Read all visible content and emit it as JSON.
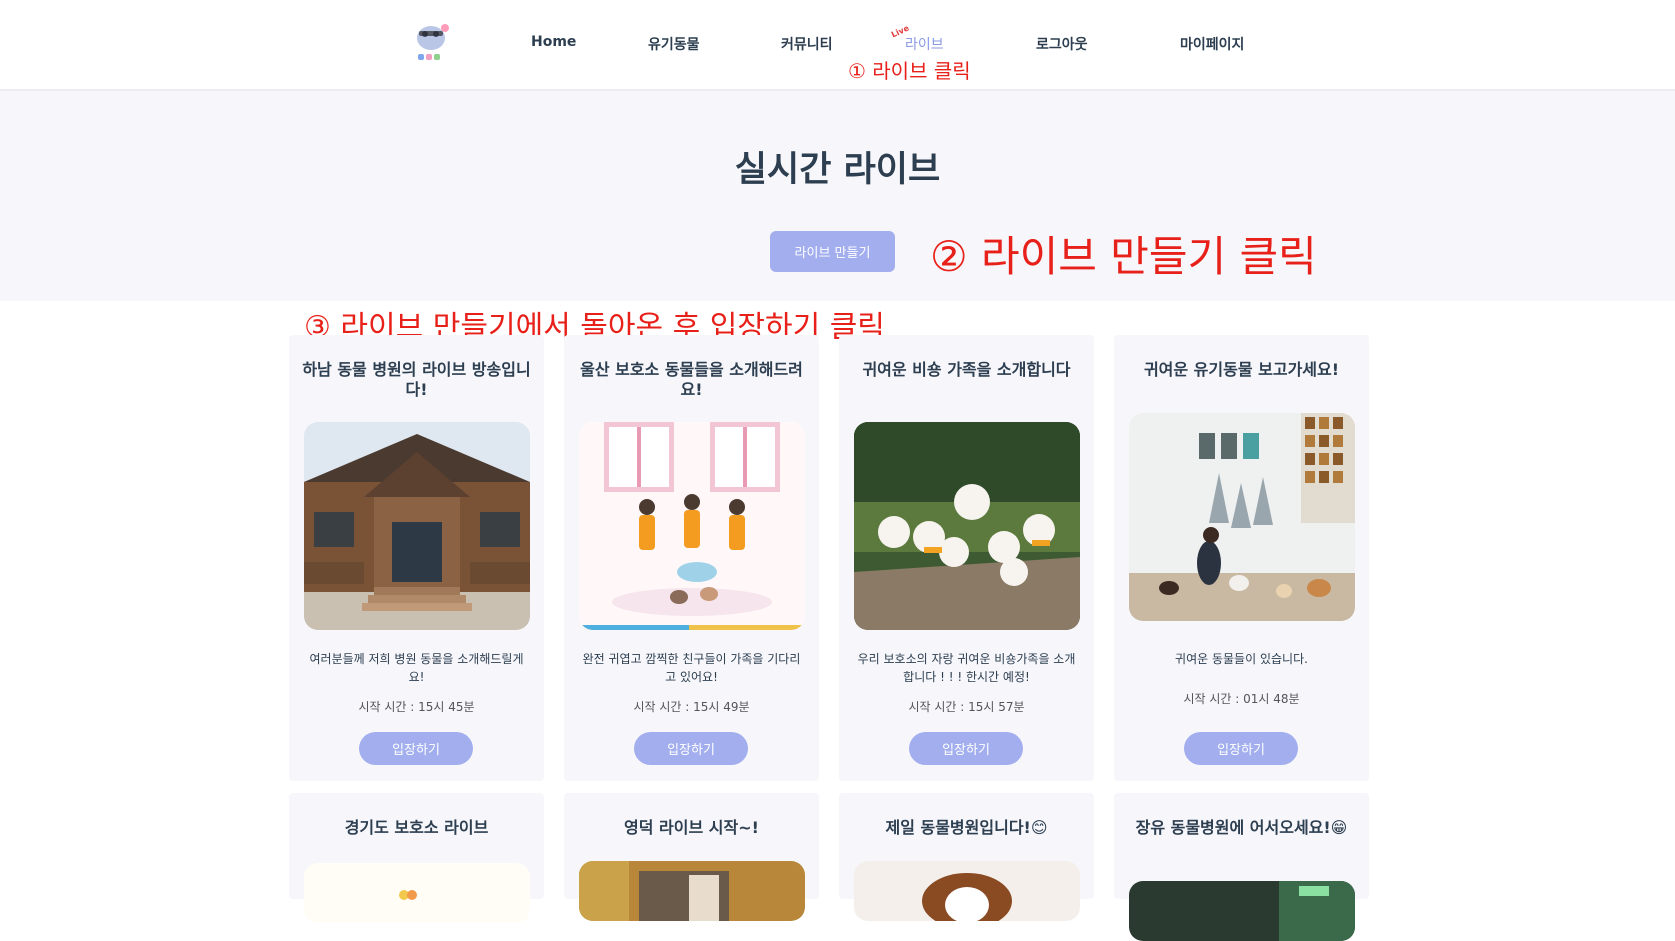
{
  "header": {
    "nav": [
      {
        "label": "Home"
      },
      {
        "label": "유기동물"
      },
      {
        "label": "커뮤니티"
      },
      {
        "label": "라이브",
        "badge": "Live"
      },
      {
        "label": "로그아웃"
      },
      {
        "label": "마이페이지"
      }
    ]
  },
  "hero": {
    "title": "실시간 라이브",
    "create_button": "라이브 만들기"
  },
  "annotations": {
    "step1": "① 라이브 클릭",
    "step2": "② 라이브 만들기 클릭",
    "step3": "③ 라이브 만들기에서 돌아온 후 입장하기 클릭",
    "color": "#e8201a"
  },
  "cards": [
    {
      "title": "하남 동물 병원의 라이브 방송입니다!",
      "desc": "여러분들께 저희 병원 동물을 소개해드릴게요!",
      "time": "시작 시간 : 15시 45분",
      "button": "입장하기"
    },
    {
      "title": "울산 보호소 동물들을 소개해드려요!",
      "desc": "완전 귀엽고 깜찍한 친구들이 가족을 기다리고 있어요!",
      "time": "시작 시간 : 15시 49분",
      "button": "입장하기"
    },
    {
      "title": "귀여운 비숑 가족을 소개합니다",
      "desc": "우리 보호소의 자랑 귀여운 비숑가족을 소개합니다 ! ! ! 한시간 예정!",
      "time": "시작 시간 : 15시 57분",
      "button": "입장하기"
    },
    {
      "title": "귀여운 유기동물 보고가세요!",
      "desc": "귀여운 동물들이 있습니다.",
      "time": "시작 시간 : 01시 48분",
      "button": "입장하기"
    },
    {
      "title": "경기도 보호소 라이브"
    },
    {
      "title": "영덕 라이브 시작~!"
    },
    {
      "title": "제일 동물병원입니다!😊"
    },
    {
      "title": "장유 동물병원에 어서오세요!😁"
    }
  ],
  "colors": {
    "accent": "#a2aeee",
    "nav_active": "#8a9ae6",
    "card_bg": "#f7f7fb",
    "text": "#2c3e50"
  }
}
